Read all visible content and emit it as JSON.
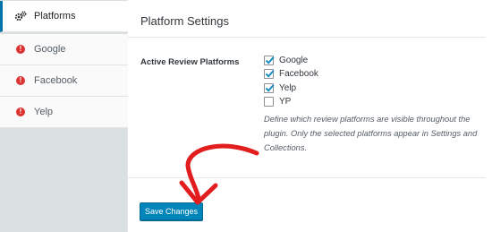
{
  "sidebar": {
    "items": [
      {
        "label": "Platforms",
        "icon": "gears-icon",
        "active": true
      },
      {
        "label": "Google",
        "icon": "alert-icon"
      },
      {
        "label": "Facebook",
        "icon": "alert-icon"
      },
      {
        "label": "Yelp",
        "icon": "alert-icon"
      }
    ]
  },
  "main": {
    "title": "Platform Settings",
    "field_label": "Active Review Platforms",
    "options": [
      {
        "label": "Google",
        "checked": true
      },
      {
        "label": "Facebook",
        "checked": true
      },
      {
        "label": "Yelp",
        "checked": true
      },
      {
        "label": "YP",
        "checked": false
      }
    ],
    "description": "Define which review platforms are visible throughout the plugin. Only the selected platforms appear in Settings and Collections.",
    "save_label": "Save Changes"
  },
  "colors": {
    "accent": "#0085ba",
    "alert": "#dc3232",
    "annotation_arrow": "#e21d1d"
  }
}
